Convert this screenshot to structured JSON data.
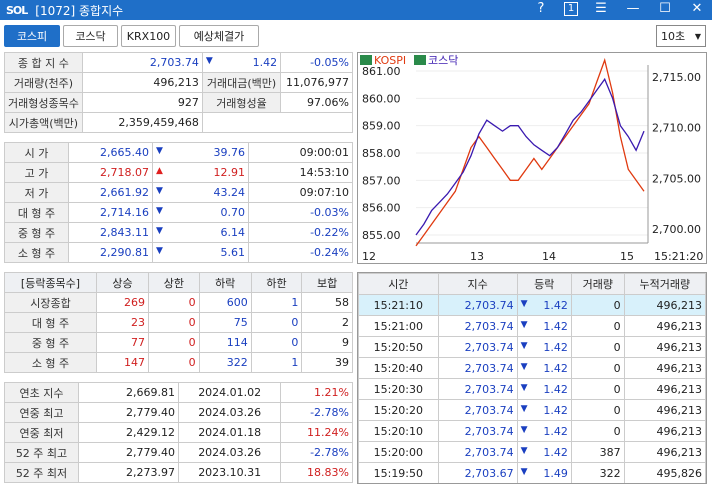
{
  "window": {
    "logo": "SOL",
    "title": "[1072] 종합지수",
    "help": "?",
    "box": "1",
    "menu": "☰",
    "min": "—",
    "max": "☐",
    "close": "✕"
  },
  "toolbar": {
    "tabs": [
      "코스피",
      "코스닥",
      "KRX100",
      "예상체결가"
    ],
    "interval": "10초"
  },
  "summary": {
    "row1": {
      "label": "종 합 지 수",
      "value": "2,703.74",
      "change": "1.42",
      "rate": "-0.05%"
    },
    "row2": {
      "label1": "거래량(천주)",
      "value1": "496,213",
      "label2": "거래대금(백만)",
      "value2": "11,076,977"
    },
    "row3": {
      "label1": "거래형성종목수",
      "value1": "927",
      "label2": "거래형성율",
      "value2": "97.06%"
    },
    "row4": {
      "label": "시가총액(백만)",
      "value": "2,359,459,468"
    }
  },
  "prices": [
    {
      "label": "시 가",
      "value": "2,665.40",
      "dir": "dn",
      "change": "39.76",
      "extra": "09:00:01"
    },
    {
      "label": "고 가",
      "value": "2,718.07",
      "dir": "up",
      "change": "12.91",
      "extra": "14:53:10"
    },
    {
      "label": "저 가",
      "value": "2,661.92",
      "dir": "dn",
      "change": "43.24",
      "extra": "09:07:10"
    },
    {
      "label": "대 형 주",
      "value": "2,714.16",
      "dir": "dn",
      "change": "0.70",
      "extra": "-0.03%"
    },
    {
      "label": "중 형 주",
      "value": "2,843.11",
      "dir": "dn",
      "change": "6.14",
      "extra": "-0.22%"
    },
    {
      "label": "소 형 주",
      "value": "2,290.81",
      "dir": "dn",
      "change": "5.61",
      "extra": "-0.24%"
    }
  ],
  "breadth": {
    "headers": [
      "[등락종목수]",
      "상승",
      "상한",
      "하락",
      "하한",
      "보합"
    ],
    "rows": [
      {
        "label": "시장종합",
        "up": "269",
        "upl": "0",
        "dn": "600",
        "dnl": "1",
        "flat": "58"
      },
      {
        "label": "대 형 주",
        "up": "23",
        "upl": "0",
        "dn": "75",
        "dnl": "0",
        "flat": "2"
      },
      {
        "label": "중 형 주",
        "up": "77",
        "upl": "0",
        "dn": "114",
        "dnl": "0",
        "flat": "9"
      },
      {
        "label": "소 형 주",
        "up": "147",
        "upl": "0",
        "dn": "322",
        "dnl": "1",
        "flat": "39"
      }
    ]
  },
  "records": [
    {
      "label": "연초 지수",
      "value": "2,669.81",
      "date": "2024.01.02",
      "rate": "1.21%",
      "color": "red"
    },
    {
      "label": "연중 최고",
      "value": "2,779.40",
      "date": "2024.03.26",
      "rate": "-2.78%",
      "color": "blue"
    },
    {
      "label": "연중 최저",
      "value": "2,429.12",
      "date": "2024.01.18",
      "rate": "11.24%",
      "color": "red"
    },
    {
      "label": "52 주 최고",
      "value": "2,779.40",
      "date": "2024.03.26",
      "rate": "-2.78%",
      "color": "blue"
    },
    {
      "label": "52 주 최저",
      "value": "2,273.97",
      "date": "2023.10.31",
      "rate": "18.83%",
      "color": "red"
    }
  ],
  "ticks": {
    "headers": [
      "시간",
      "지수",
      "등락",
      "거래량",
      "누적거래량"
    ],
    "rows": [
      {
        "time": "15:21:10",
        "index": "2,703.74",
        "change": "1.42",
        "vol": "0",
        "cum": "496,213"
      },
      {
        "time": "15:21:00",
        "index": "2,703.74",
        "change": "1.42",
        "vol": "0",
        "cum": "496,213"
      },
      {
        "time": "15:20:50",
        "index": "2,703.74",
        "change": "1.42",
        "vol": "0",
        "cum": "496,213"
      },
      {
        "time": "15:20:40",
        "index": "2,703.74",
        "change": "1.42",
        "vol": "0",
        "cum": "496,213"
      },
      {
        "time": "15:20:30",
        "index": "2,703.74",
        "change": "1.42",
        "vol": "0",
        "cum": "496,213"
      },
      {
        "time": "15:20:20",
        "index": "2,703.74",
        "change": "1.42",
        "vol": "0",
        "cum": "496,213"
      },
      {
        "time": "15:20:10",
        "index": "2,703.74",
        "change": "1.42",
        "vol": "0",
        "cum": "496,213"
      },
      {
        "time": "15:20:00",
        "index": "2,703.74",
        "change": "1.42",
        "vol": "387",
        "cum": "496,213"
      },
      {
        "time": "15:19:50",
        "index": "2,703.67",
        "change": "1.49",
        "vol": "322",
        "cum": "495,826"
      }
    ]
  },
  "chart_data": {
    "type": "line",
    "legend": [
      "KOSPI",
      "코스닥"
    ],
    "series_colors": {
      "KOSPI": "#e03a10",
      "코스닥": "#3a1ab0"
    },
    "left_axis": {
      "ticks": [
        "861.00",
        "860.00",
        "859.00",
        "858.00",
        "857.00",
        "856.00",
        "855.00"
      ],
      "range": [
        855,
        861
      ]
    },
    "right_axis": {
      "ticks": [
        "2,715.00",
        "2,710.00",
        "2,705.00",
        "2,700.00"
      ],
      "range": [
        2700,
        2715
      ]
    },
    "x_labels": [
      "12",
      "13",
      "14",
      "15",
      "15:21:20"
    ],
    "series": [
      {
        "name": "KOSPI",
        "axis": "right",
        "values": [
          2699,
          2700,
          2701,
          2702,
          2703,
          2704,
          2706,
          2708,
          2709,
          2708,
          2707,
          2706,
          2705,
          2705,
          2706,
          2707,
          2706,
          2707,
          2708,
          2709,
          2710,
          2711,
          2712,
          2714,
          2716,
          2713,
          2709,
          2706,
          2705,
          2704
        ]
      },
      {
        "name": "코스닥",
        "axis": "left",
        "values": [
          855.0,
          855.4,
          855.9,
          856.2,
          856.5,
          856.9,
          857.3,
          857.9,
          858.7,
          859.2,
          859.0,
          858.8,
          859.0,
          859.0,
          858.6,
          858.3,
          858.1,
          857.9,
          858.2,
          858.7,
          859.2,
          859.5,
          859.9,
          860.3,
          860.7,
          860.0,
          859.0,
          858.6,
          858.1,
          858.8
        ]
      }
    ]
  }
}
